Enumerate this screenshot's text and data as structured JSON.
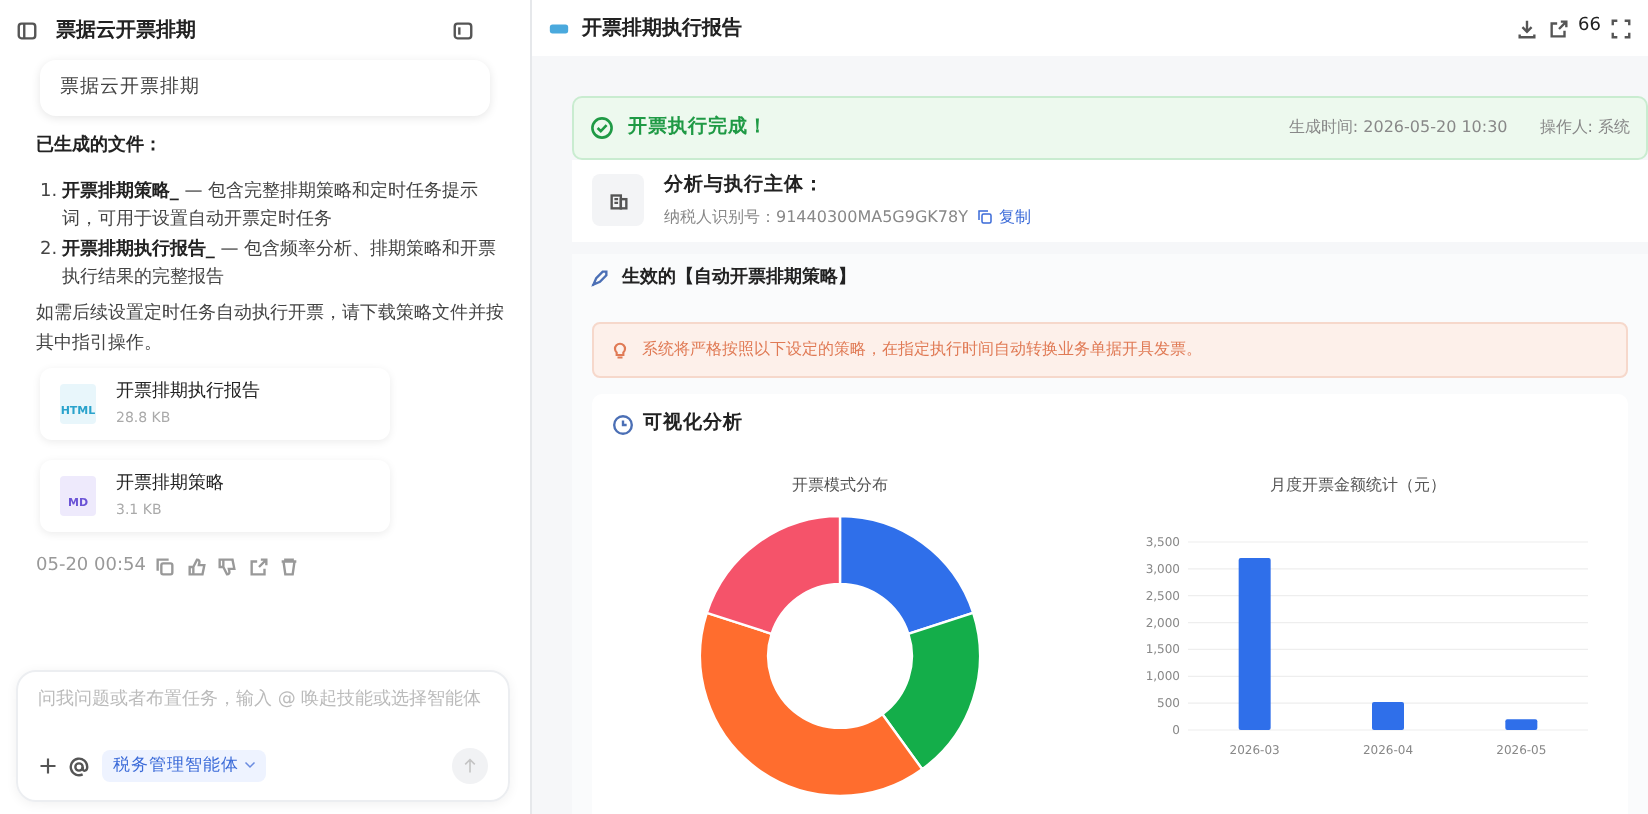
{
  "left_panel": {
    "title": "票据云开票排期",
    "user_message": "票据云开票排期",
    "files_heading": "已生成的文件：",
    "file_list": [
      {
        "number": "1.",
        "text": "**开票排期策略_** — 包含完整排期策略和定时任务提示词，可用于设置自动开票定时任务"
      },
      {
        "number": "2.",
        "text": "**开票排期执行报告_** — 包含频率分析、排期策略和开票执行结果的完整报告"
      }
    ],
    "note": "如需后续设置定时任务自动执行开票，请下载策略文件并按其中指引操作。",
    "attachments": [
      {
        "type": "HTML",
        "name": "开票排期执行报告",
        "size": "28.8 KB"
      },
      {
        "type": "MD",
        "name": "开票排期策略",
        "size": "3.1 KB"
      }
    ],
    "timestamp": "05-20 00:54",
    "composer": {
      "placeholder": "问我问题或者布置任务，输入 @ 唤起技能或选择智能体",
      "agent": "税务管理智能体"
    }
  },
  "report": {
    "title": "开票排期执行报告",
    "toolbar_count": "66",
    "status": {
      "message": "开票执行完成！",
      "generated": "生成时间: 2026-05-20 10:30",
      "operator": "操作人: 系统"
    },
    "entity": {
      "label": "分析与执行主体：",
      "tax_id": "纳税人识别号：91440300MA5G9GK78Y",
      "copy": "复制"
    },
    "strategy": {
      "title": "生效的【自动开票排期策略】",
      "notice": "系统将严格按照以下设定的策略，在指定执行时间自动转换业务单据开具发票。"
    },
    "visual": {
      "title": "可视化分析",
      "donut_title": "开票模式分布",
      "chart_data": {
        "type": "bar",
        "title": "月度开票金额统计（元）",
        "categories": [
          "2026-03",
          "2026-04",
          "2026-05"
        ],
        "values": [
          3200,
          520,
          200
        ],
        "ylim": [
          0,
          3500
        ],
        "grid": true,
        "yticks": [
          {
            "value": 0,
            "label": "0"
          },
          {
            "value": 500,
            "label": "500"
          },
          {
            "value": 1000,
            "label": "1,000"
          },
          {
            "value": 1500,
            "label": "1,500"
          },
          {
            "value": 2000,
            "label": "2,000"
          },
          {
            "value": 2500,
            "label": "2,500"
          },
          {
            "value": 3000,
            "label": "3,000"
          },
          {
            "value": 3500,
            "label": "3,500"
          }
        ]
      }
    }
  }
}
